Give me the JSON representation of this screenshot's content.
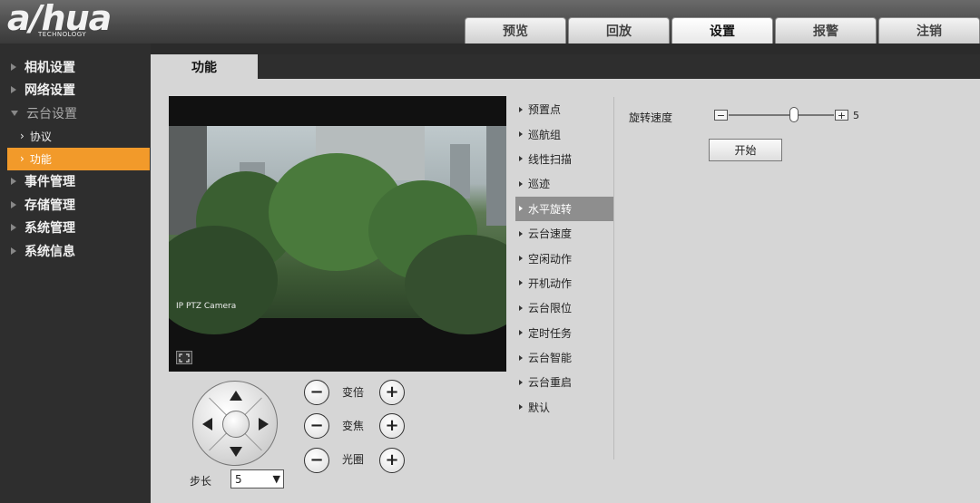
{
  "brand": {
    "logo_text": "a/hua",
    "logo_sub": "TECHNOLOGY"
  },
  "nav": {
    "tabs": [
      "预览",
      "回放",
      "设置",
      "报警",
      "注销"
    ],
    "active": "设置"
  },
  "sidebar": {
    "items": [
      {
        "label": "相机设置"
      },
      {
        "label": "网络设置"
      },
      {
        "label": "云台设置",
        "expanded": true
      },
      {
        "label": "协议",
        "sub": true
      },
      {
        "label": "功能",
        "sub": true,
        "active": true
      },
      {
        "label": "事件管理"
      },
      {
        "label": "存储管理"
      },
      {
        "label": "系统管理"
      },
      {
        "label": "系统信息"
      }
    ]
  },
  "content": {
    "tab_title": "功能"
  },
  "video": {
    "watermark": "IP PTZ Camera"
  },
  "ptz": {
    "zoom_label": "变倍",
    "focus_label": "变焦",
    "iris_label": "光圈",
    "minus_glyph": "−",
    "plus_glyph": "+",
    "step_label": "步长",
    "step_value": "5"
  },
  "functions": {
    "items": [
      "预置点",
      "巡航组",
      "线性扫描",
      "巡迹",
      "水平旋转",
      "云台速度",
      "空闲动作",
      "开机动作",
      "云台限位",
      "定时任务",
      "云台智能",
      "云台重启",
      "默认"
    ],
    "active": "水平旋转"
  },
  "pan": {
    "speed_label": "旋转速度",
    "speed_value": "5",
    "slider_fraction": 0.62,
    "start_label": "开始"
  },
  "colors": {
    "accent": "#f29a2a",
    "active_fn": "#8e8e8e",
    "content_bg": "#d6d6d6",
    "sidebar_bg": "#2e2e2e"
  }
}
